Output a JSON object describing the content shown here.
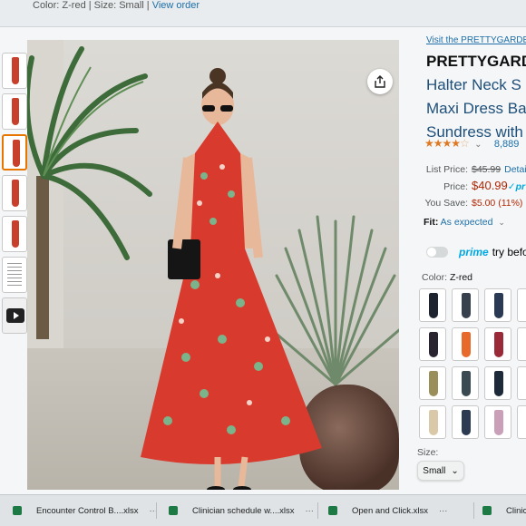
{
  "order_line": {
    "color_label": "Color:",
    "color_value": "Z-red",
    "size_label": "Size:",
    "size_value": "Small",
    "sep": "|",
    "view_order": "View order"
  },
  "product": {
    "visit_link": "Visit the PRETTYGARDE",
    "title_lines": [
      "PRETTYGARD",
      "Halter Neck S",
      "Maxi Dress Ba",
      "Sundress with"
    ],
    "rating": {
      "stars": "★★★★",
      "half_star": "☆",
      "count": "8,889"
    },
    "list_price_label": "List Price:",
    "list_price": "$45.99",
    "details": "Detail",
    "price_label": "Price:",
    "price": "$40.99",
    "prime_check": "✓pr",
    "you_save_label": "You Save:",
    "you_save": "$5.00 (11%)",
    "fit_label": "Fit:",
    "fit_value": "As expected",
    "prime_word": "prime",
    "prime_try": "try befo",
    "color_label": "Color:",
    "color_value": "Z-red",
    "size_label": "Size:",
    "size_value": "Small"
  },
  "colors": {
    "swatches": [
      "#1e2330",
      "#37404d",
      "#2a3a55",
      "#0c1a3a",
      "#2a2430",
      "#e86a2a",
      "#9a2a38",
      "#ffffff",
      "#9a8f5a",
      "#3a4a52",
      "#1c2a3a",
      "#0e2a5a",
      "#d9c9a8",
      "#2c3a52",
      "#c9a0b8",
      "#ffffff"
    ],
    "thumb_dress": "#c8402c",
    "accent_orange": "#e77600",
    "link_blue": "#1e6fa8",
    "price_red": "#b12704",
    "prime_blue": "#00a8e1"
  },
  "taskbar": {
    "items": [
      {
        "label": "Encounter Control B....xlsx",
        "more": "···"
      },
      {
        "label": "Clinician schedule w....xlsx",
        "more": "···"
      },
      {
        "label": "Open and Click.xlsx",
        "more": "···"
      },
      {
        "label": "Clinicia",
        "more": ""
      }
    ]
  },
  "icons": {
    "share": "share-icon",
    "chevron": "chevron-down-icon",
    "play": "play-icon",
    "excel": "excel-icon"
  }
}
